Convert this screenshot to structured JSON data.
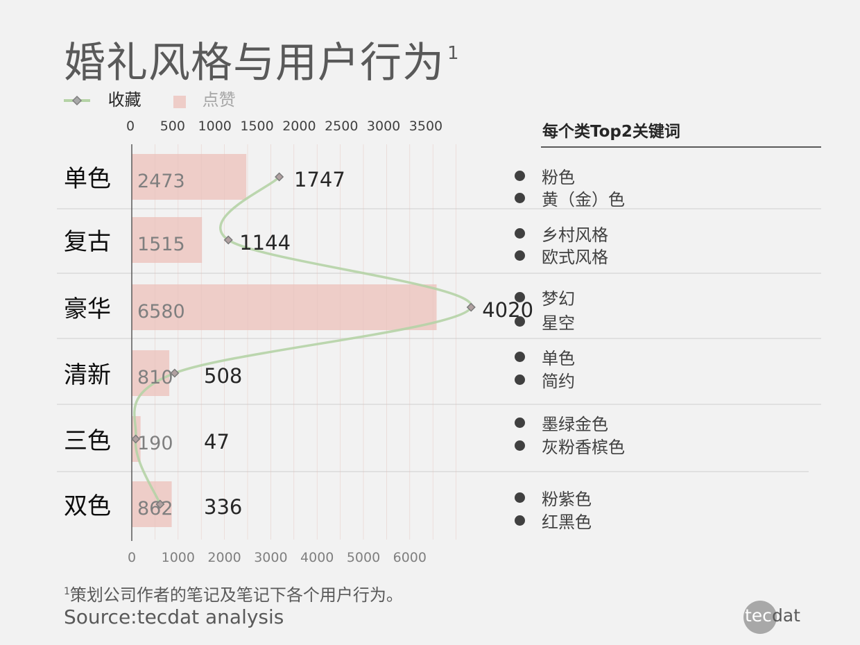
{
  "title": "婚礼风格与用户行为",
  "title_sup": "1",
  "legend": {
    "line_label": "收藏",
    "bar_label": "点赞"
  },
  "keywords_header": "每个类Top2关键词",
  "footnote_sup": "1",
  "footnote": "策划公司作者的笔记及笔记下各个用户行为。",
  "source": "Source:tecdat analysis",
  "logo": {
    "part1": "tec",
    "part2": "dat"
  },
  "colors": {
    "bar": "#eecdc8",
    "line": "#b5d3a6",
    "marker": "#8c8c8c",
    "axis": "#595959",
    "divider": "#d9d9d9"
  },
  "chart_data": {
    "type": "bar",
    "orientation": "horizontal",
    "categories": [
      "单色",
      "复古",
      "豪华",
      "清新",
      "三色",
      "双色"
    ],
    "series": [
      {
        "name": "点赞",
        "type": "bar",
        "axis": "bottom",
        "values": [
          2473,
          1515,
          6580,
          810,
          190,
          862
        ]
      },
      {
        "name": "收藏",
        "type": "line",
        "axis": "top",
        "values": [
          1747,
          1144,
          4020,
          508,
          47,
          336
        ]
      }
    ],
    "bottom_axis": {
      "ticks": [
        "0",
        "1000",
        "2000",
        "3000",
        "4000",
        "5000",
        "6000"
      ],
      "range": [
        0,
        7000
      ]
    },
    "top_axis": {
      "ticks": [
        "0",
        "500",
        "1000",
        "1500",
        "2000",
        "2500",
        "3000",
        "3500"
      ],
      "range": [
        0,
        3500
      ]
    },
    "keywords": [
      [
        "粉色",
        "黄（金）色"
      ],
      [
        "乡村风格",
        "欧式风格"
      ],
      [
        "梦幻",
        "星空"
      ],
      [
        "单色",
        "简约"
      ],
      [
        "墨绿金色",
        "灰粉香槟色"
      ],
      [
        "粉紫色",
        "红黑色"
      ]
    ],
    "legend_position": "top-left"
  }
}
